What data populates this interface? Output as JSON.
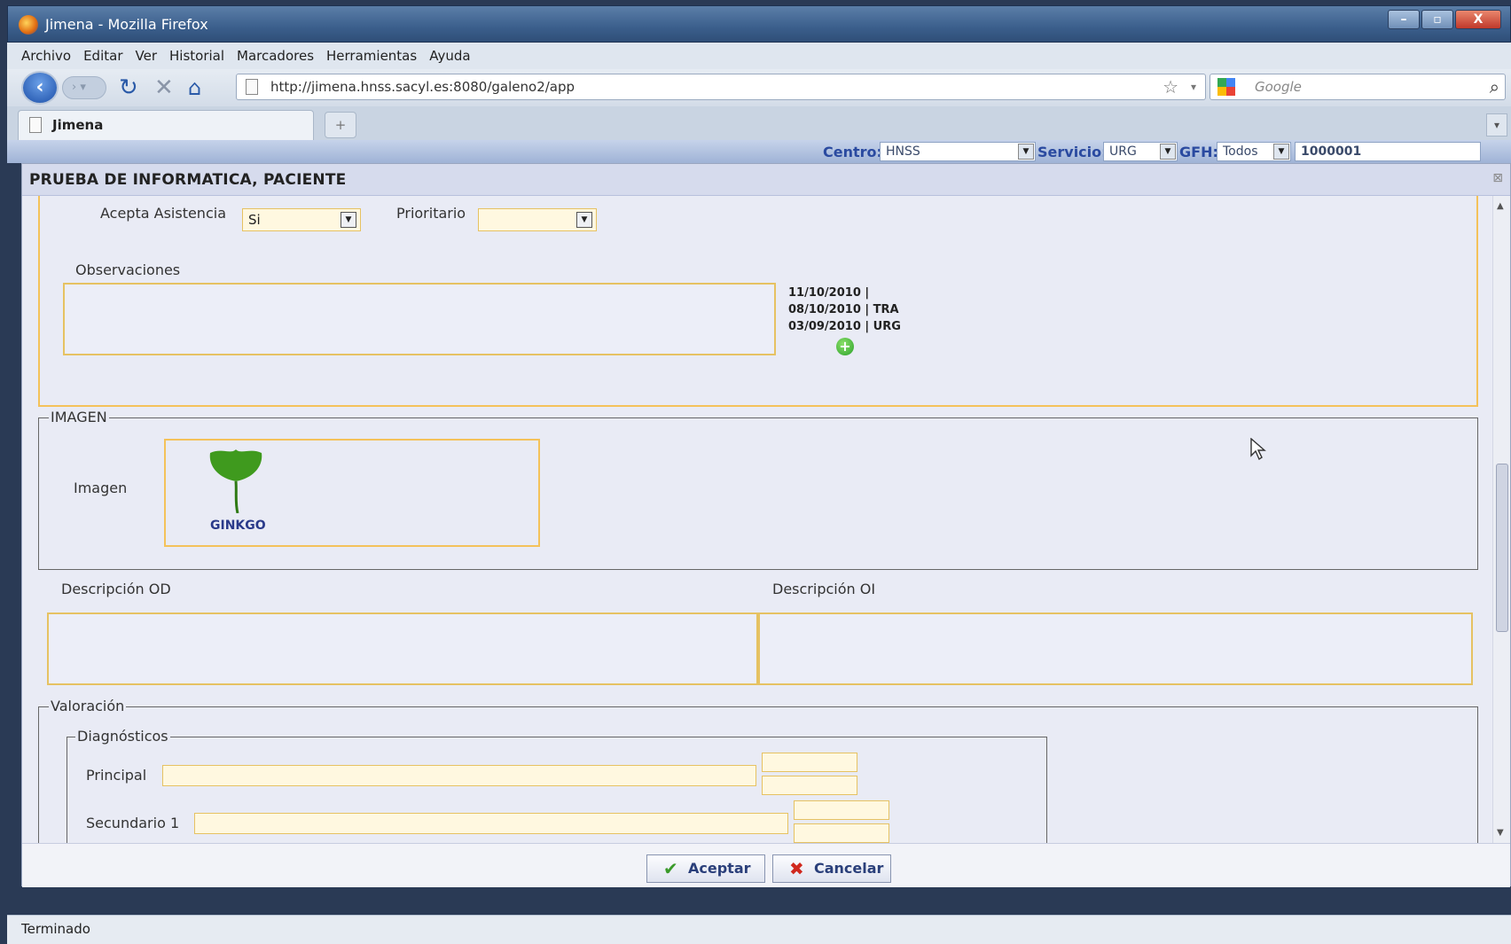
{
  "window": {
    "title": "Jimena - Mozilla Firefox",
    "buttons": [
      "–",
      "▫",
      "X"
    ]
  },
  "menu": [
    "Archivo",
    "Editar",
    "Ver",
    "Historial",
    "Marcadores",
    "Herramientas",
    "Ayuda"
  ],
  "nav": {
    "url": "http://jimena.hnss.sacyl.es:8080/galeno2/app",
    "search_placeholder": "Google"
  },
  "tab": {
    "title": "Jimena",
    "new_tab": "+"
  },
  "appbar": {
    "centro_label": "Centro:",
    "centro_value": "HNSS",
    "servicio_label": "Servicio:",
    "servicio_value": "URG",
    "gfh_label": "GFH:",
    "gfh_value": "Todos",
    "id_value": "1000001"
  },
  "dialog": {
    "title": "PRUEBA DE INFORMATICA, PACIENTE",
    "acepta_label": "Acepta Asistencia",
    "acepta_value": "Si",
    "prioritario_label": "Prioritario",
    "prioritario_value": "",
    "observaciones_label": "Observaciones",
    "history": [
      "11/10/2010 |",
      "08/10/2010 | TRA",
      "03/09/2010 | URG"
    ],
    "imagen_section": "IMAGEN",
    "imagen_label": "Imagen",
    "imagen_caption": "GINKGO",
    "desc_od_label": "Descripción OD",
    "desc_oi_label": "Descripción OI",
    "valoracion_section": "Valoración",
    "diagnosticos_section": "Diagnósticos",
    "principal_label": "Principal",
    "secundario1_label": "Secundario 1",
    "accept_label": "Aceptar",
    "cancel_label": "Cancelar"
  },
  "status": {
    "text": "Terminado"
  },
  "colors": {
    "field_border": "#e6c262",
    "section_border": "#f4c25a",
    "button_text": "#2a3f7a",
    "title_blue": "#2a4aa0"
  }
}
